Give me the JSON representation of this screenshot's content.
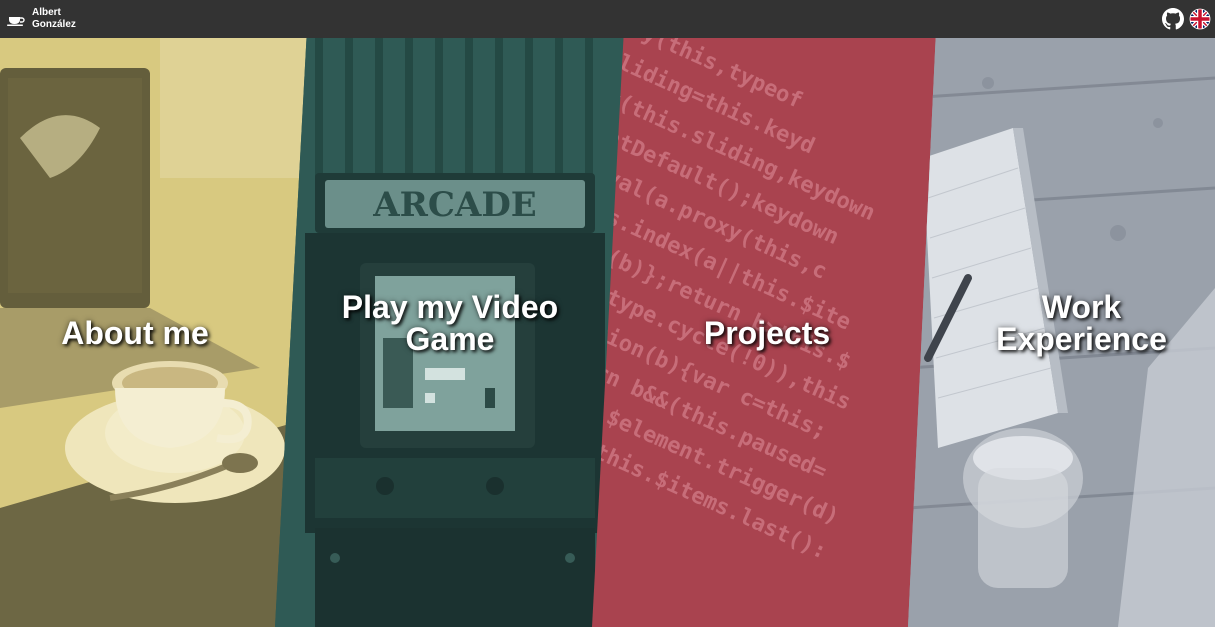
{
  "header": {
    "brand_first": "Albert",
    "brand_last": "González",
    "brand_icon": "coffee-cup-icon",
    "github_icon": "github-icon",
    "language_icon": "uk-flag-icon"
  },
  "panels": [
    {
      "title": "About me",
      "tint": "#d8c980",
      "image": "laptop-and-coffee-photo"
    },
    {
      "title": "Play my Video Game",
      "tint": "#2f5a55",
      "image": "arcade-cabinet-photo"
    },
    {
      "title": "Projects",
      "tint": "#a9434f",
      "image": "source-code-photo"
    },
    {
      "title": "Work Experience",
      "tint": "#9aa1ab",
      "image": "desk-with-notebook-and-glass-photo"
    }
  ]
}
